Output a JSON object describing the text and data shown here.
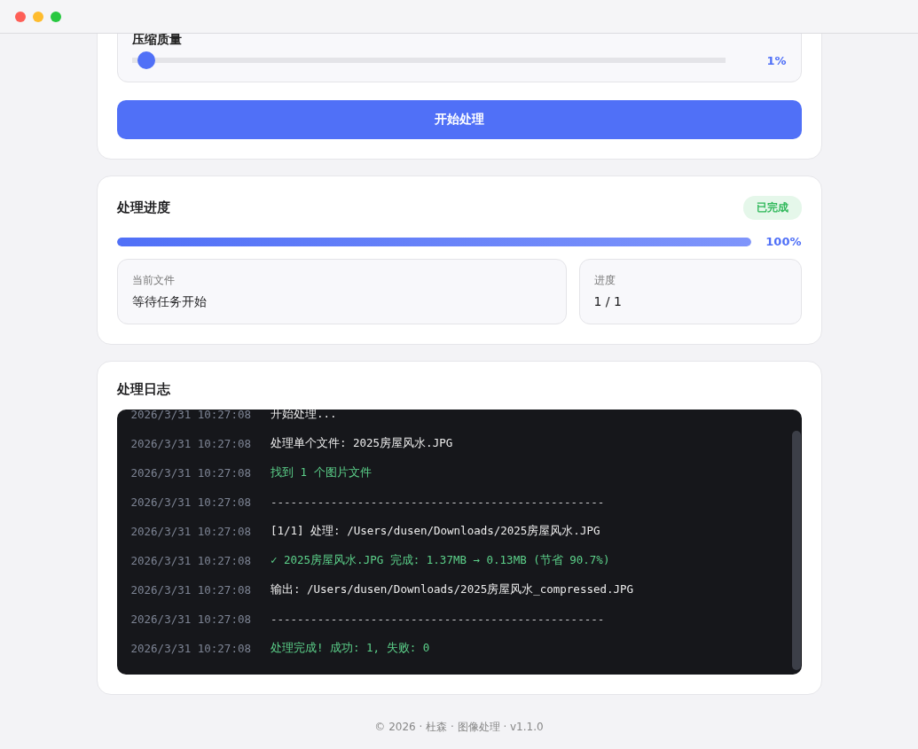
{
  "settings": {
    "quality": {
      "label": "压缩质量",
      "level": 0.01,
      "reading": "1%"
    },
    "start_button": "开始处理"
  },
  "progress": {
    "title": "处理进度",
    "status": {
      "label": "已完成",
      "kind": "done"
    },
    "level": 1,
    "reading": "100%",
    "stats": [
      {
        "label": "当前文件",
        "value": "等待任务开始"
      },
      {
        "label": "进度",
        "value": "1 / 1"
      }
    ]
  },
  "log": {
    "title": "处理日志",
    "entries": [
      {
        "time": "2026/3/31 10:27:08",
        "message": "开始处理...",
        "kind": "info"
      },
      {
        "time": "2026/3/31 10:27:08",
        "message": "处理单个文件: 2025房屋风水.JPG",
        "kind": "info"
      },
      {
        "time": "2026/3/31 10:27:08",
        "message": "找到 1 个图片文件",
        "kind": "success"
      },
      {
        "time": "2026/3/31 10:27:08",
        "message": "--------------------------------------------------",
        "kind": "divider"
      },
      {
        "time": "2026/3/31 10:27:08",
        "message": "[1/1] 处理: /Users/dusen/Downloads/2025房屋风水.JPG",
        "kind": "info"
      },
      {
        "time": "2026/3/31 10:27:08",
        "message": "✓ 2025房屋风水.JPG 完成: 1.37MB → 0.13MB (节省 90.7%)",
        "kind": "success"
      },
      {
        "time": "2026/3/31 10:27:08",
        "message": "输出: /Users/dusen/Downloads/2025房屋风水_compressed.JPG",
        "kind": "info"
      },
      {
        "time": "2026/3/31 10:27:08",
        "message": "--------------------------------------------------",
        "kind": "divider"
      },
      {
        "time": "2026/3/31 10:27:08",
        "message": "处理完成! 成功: 1, 失败: 0",
        "kind": "success"
      }
    ]
  },
  "footer": "© 2026 · 杜森 · 图像处理 · v1.1.0"
}
